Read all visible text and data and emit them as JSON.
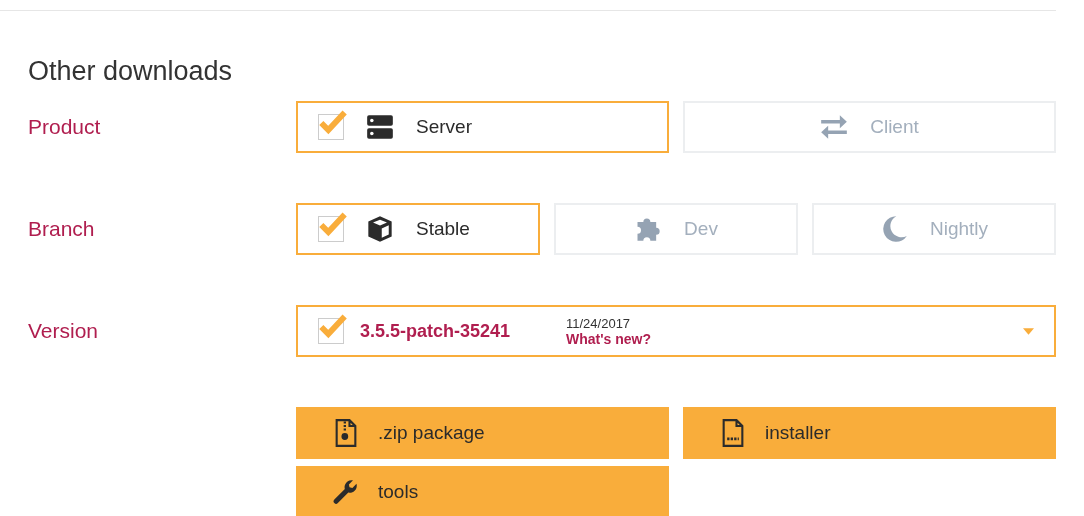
{
  "title": "Other downloads",
  "product": {
    "label": "Product",
    "options": [
      {
        "label": "Server",
        "kind": "server",
        "selected": true
      },
      {
        "label": "Client",
        "kind": "arrows",
        "selected": false
      }
    ]
  },
  "branch": {
    "label": "Branch",
    "options": [
      {
        "label": "Stable",
        "kind": "cube",
        "selected": true
      },
      {
        "label": "Dev",
        "kind": "puzzle",
        "selected": false
      },
      {
        "label": "Nightly",
        "kind": "moon",
        "selected": false
      }
    ]
  },
  "version": {
    "label": "Version",
    "selected": true,
    "value": "3.5.5-patch-35241",
    "date": "11/24/2017",
    "link": "What's new?"
  },
  "downloads": [
    {
      "label": ".zip package",
      "kind": "zip"
    },
    {
      "label": "installer",
      "kind": "exe"
    },
    {
      "label": "tools",
      "kind": "wrench"
    }
  ]
}
